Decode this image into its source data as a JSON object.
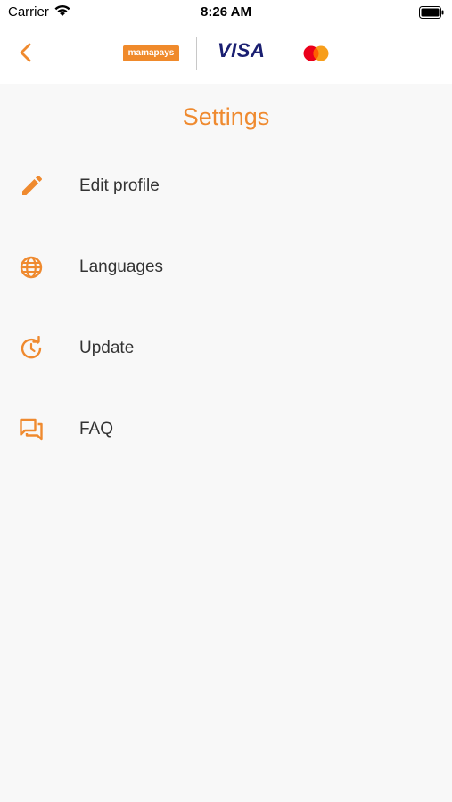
{
  "status_bar": {
    "carrier": "Carrier",
    "time": "8:26 AM"
  },
  "header": {
    "back_icon": "chevron-left-icon",
    "logos": {
      "mamapays": "mamapays",
      "visa": "VISA",
      "mastercard": "mastercard-logo"
    }
  },
  "page": {
    "title": "Settings"
  },
  "menu": {
    "items": [
      {
        "label": "Edit profile",
        "icon": "pencil-icon"
      },
      {
        "label": "Languages",
        "icon": "globe-icon"
      },
      {
        "label": "Update",
        "icon": "update-icon"
      },
      {
        "label": "FAQ",
        "icon": "chat-icon"
      }
    ]
  },
  "colors": {
    "accent": "#ef8a2f",
    "background": "#f8f8f8",
    "text": "#333333"
  }
}
